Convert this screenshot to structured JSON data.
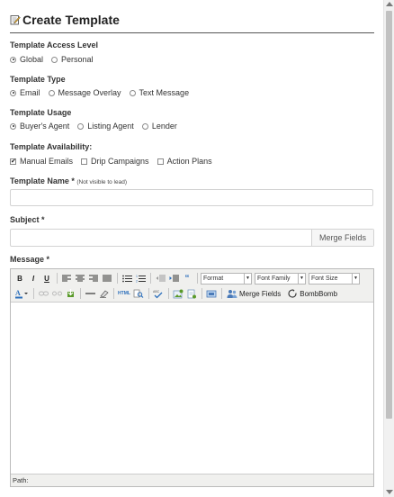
{
  "title": "Create Template",
  "access_level": {
    "label": "Template Access Level",
    "options": [
      {
        "label": "Global",
        "selected": true
      },
      {
        "label": "Personal",
        "selected": false
      }
    ]
  },
  "type": {
    "label": "Template Type",
    "options": [
      {
        "label": "Email",
        "selected": true
      },
      {
        "label": "Message Overlay",
        "selected": false
      },
      {
        "label": "Text Message",
        "selected": false
      }
    ]
  },
  "usage": {
    "label": "Template Usage",
    "options": [
      {
        "label": "Buyer's Agent",
        "selected": true
      },
      {
        "label": "Listing Agent",
        "selected": false
      },
      {
        "label": "Lender",
        "selected": false
      }
    ]
  },
  "availability": {
    "label": "Template Availability:",
    "options": [
      {
        "label": "Manual Emails",
        "checked": true
      },
      {
        "label": "Drip Campaigns",
        "checked": false
      },
      {
        "label": "Action Plans",
        "checked": false
      }
    ]
  },
  "template_name": {
    "label": "Template Name *",
    "note": "(Not visible to lead)",
    "value": ""
  },
  "subject": {
    "label": "Subject *",
    "value": "",
    "merge_fields_label": "Merge Fields"
  },
  "message": {
    "label": "Message *",
    "toolbar": {
      "format_label": "Format",
      "font_family_label": "Font Family",
      "font_size_label": "Font Size",
      "merge_fields_label": "Merge Fields",
      "bombbomb_label": "BombBomb",
      "html_label": "HTML"
    },
    "path_label": "Path:"
  },
  "colors": {
    "accent": "#2a6ebb",
    "border": "#d3d3d3"
  }
}
